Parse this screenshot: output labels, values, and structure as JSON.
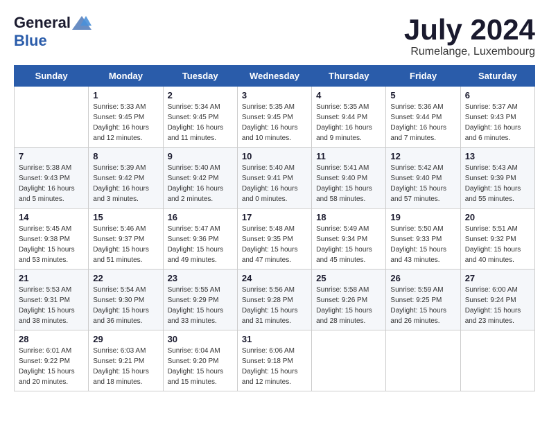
{
  "header": {
    "logo_general": "General",
    "logo_blue": "Blue",
    "month_title": "July 2024",
    "location": "Rumelange, Luxembourg"
  },
  "weekdays": [
    "Sunday",
    "Monday",
    "Tuesday",
    "Wednesday",
    "Thursday",
    "Friday",
    "Saturday"
  ],
  "weeks": [
    [
      {
        "day": "",
        "info": ""
      },
      {
        "day": "1",
        "info": "Sunrise: 5:33 AM\nSunset: 9:45 PM\nDaylight: 16 hours\nand 12 minutes."
      },
      {
        "day": "2",
        "info": "Sunrise: 5:34 AM\nSunset: 9:45 PM\nDaylight: 16 hours\nand 11 minutes."
      },
      {
        "day": "3",
        "info": "Sunrise: 5:35 AM\nSunset: 9:45 PM\nDaylight: 16 hours\nand 10 minutes."
      },
      {
        "day": "4",
        "info": "Sunrise: 5:35 AM\nSunset: 9:44 PM\nDaylight: 16 hours\nand 9 minutes."
      },
      {
        "day": "5",
        "info": "Sunrise: 5:36 AM\nSunset: 9:44 PM\nDaylight: 16 hours\nand 7 minutes."
      },
      {
        "day": "6",
        "info": "Sunrise: 5:37 AM\nSunset: 9:43 PM\nDaylight: 16 hours\nand 6 minutes."
      }
    ],
    [
      {
        "day": "7",
        "info": "Sunrise: 5:38 AM\nSunset: 9:43 PM\nDaylight: 16 hours\nand 5 minutes."
      },
      {
        "day": "8",
        "info": "Sunrise: 5:39 AM\nSunset: 9:42 PM\nDaylight: 16 hours\nand 3 minutes."
      },
      {
        "day": "9",
        "info": "Sunrise: 5:40 AM\nSunset: 9:42 PM\nDaylight: 16 hours\nand 2 minutes."
      },
      {
        "day": "10",
        "info": "Sunrise: 5:40 AM\nSunset: 9:41 PM\nDaylight: 16 hours\nand 0 minutes."
      },
      {
        "day": "11",
        "info": "Sunrise: 5:41 AM\nSunset: 9:40 PM\nDaylight: 15 hours\nand 58 minutes."
      },
      {
        "day": "12",
        "info": "Sunrise: 5:42 AM\nSunset: 9:40 PM\nDaylight: 15 hours\nand 57 minutes."
      },
      {
        "day": "13",
        "info": "Sunrise: 5:43 AM\nSunset: 9:39 PM\nDaylight: 15 hours\nand 55 minutes."
      }
    ],
    [
      {
        "day": "14",
        "info": "Sunrise: 5:45 AM\nSunset: 9:38 PM\nDaylight: 15 hours\nand 53 minutes."
      },
      {
        "day": "15",
        "info": "Sunrise: 5:46 AM\nSunset: 9:37 PM\nDaylight: 15 hours\nand 51 minutes."
      },
      {
        "day": "16",
        "info": "Sunrise: 5:47 AM\nSunset: 9:36 PM\nDaylight: 15 hours\nand 49 minutes."
      },
      {
        "day": "17",
        "info": "Sunrise: 5:48 AM\nSunset: 9:35 PM\nDaylight: 15 hours\nand 47 minutes."
      },
      {
        "day": "18",
        "info": "Sunrise: 5:49 AM\nSunset: 9:34 PM\nDaylight: 15 hours\nand 45 minutes."
      },
      {
        "day": "19",
        "info": "Sunrise: 5:50 AM\nSunset: 9:33 PM\nDaylight: 15 hours\nand 43 minutes."
      },
      {
        "day": "20",
        "info": "Sunrise: 5:51 AM\nSunset: 9:32 PM\nDaylight: 15 hours\nand 40 minutes."
      }
    ],
    [
      {
        "day": "21",
        "info": "Sunrise: 5:53 AM\nSunset: 9:31 PM\nDaylight: 15 hours\nand 38 minutes."
      },
      {
        "day": "22",
        "info": "Sunrise: 5:54 AM\nSunset: 9:30 PM\nDaylight: 15 hours\nand 36 minutes."
      },
      {
        "day": "23",
        "info": "Sunrise: 5:55 AM\nSunset: 9:29 PM\nDaylight: 15 hours\nand 33 minutes."
      },
      {
        "day": "24",
        "info": "Sunrise: 5:56 AM\nSunset: 9:28 PM\nDaylight: 15 hours\nand 31 minutes."
      },
      {
        "day": "25",
        "info": "Sunrise: 5:58 AM\nSunset: 9:26 PM\nDaylight: 15 hours\nand 28 minutes."
      },
      {
        "day": "26",
        "info": "Sunrise: 5:59 AM\nSunset: 9:25 PM\nDaylight: 15 hours\nand 26 minutes."
      },
      {
        "day": "27",
        "info": "Sunrise: 6:00 AM\nSunset: 9:24 PM\nDaylight: 15 hours\nand 23 minutes."
      }
    ],
    [
      {
        "day": "28",
        "info": "Sunrise: 6:01 AM\nSunset: 9:22 PM\nDaylight: 15 hours\nand 20 minutes."
      },
      {
        "day": "29",
        "info": "Sunrise: 6:03 AM\nSunset: 9:21 PM\nDaylight: 15 hours\nand 18 minutes."
      },
      {
        "day": "30",
        "info": "Sunrise: 6:04 AM\nSunset: 9:20 PM\nDaylight: 15 hours\nand 15 minutes."
      },
      {
        "day": "31",
        "info": "Sunrise: 6:06 AM\nSunset: 9:18 PM\nDaylight: 15 hours\nand 12 minutes."
      },
      {
        "day": "",
        "info": ""
      },
      {
        "day": "",
        "info": ""
      },
      {
        "day": "",
        "info": ""
      }
    ]
  ]
}
